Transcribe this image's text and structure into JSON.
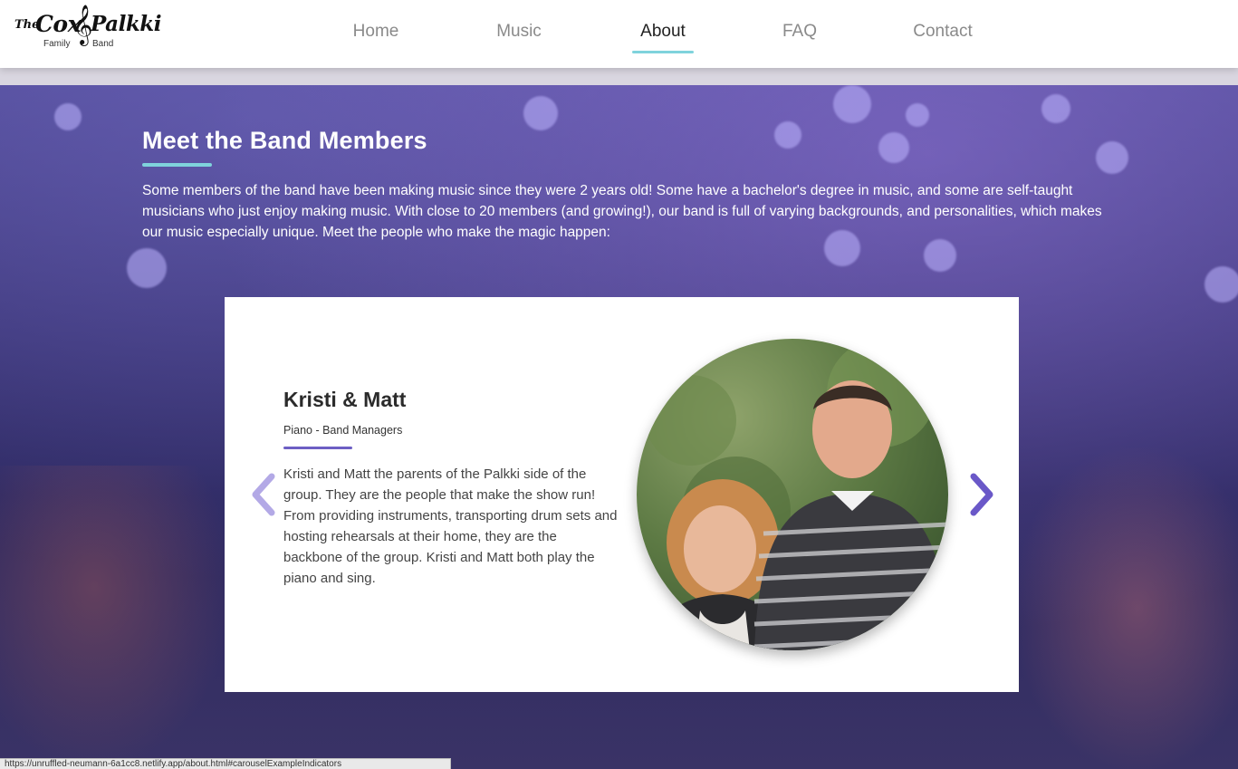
{
  "logo": {
    "the": "The",
    "cox": "Cox",
    "palkki": "Palkki",
    "family": "Family",
    "band": "Band",
    "clef_glyph": "𝄞"
  },
  "nav": {
    "items": [
      {
        "label": "Home"
      },
      {
        "label": "Music"
      },
      {
        "label": "About"
      },
      {
        "label": "FAQ"
      },
      {
        "label": "Contact"
      }
    ],
    "active": "About",
    "accent_color": "#7fd3dc"
  },
  "section": {
    "title": "Meet the Band Members",
    "intro": "Some members of the band have been making music since they were 2 years old! Some have a bachelor's degree in music, and some are self-taught musicians who just enjoy making music. With close to 20 members (and growing!), our band is full of varying backgrounds, and personalities, which makes our music especially unique. Meet the people who make the magic happen:"
  },
  "carousel": {
    "member": {
      "name": "Kristi & Matt",
      "role": "Piano - Band Managers",
      "bio": "Kristi and Matt the parents of the Palkki side of the group. They are the people that make the show run! From providing instruments, transporting drum sets and hosting rehearsals at their home, they are the backbone of the group. Kristi and Matt both play the piano and sing."
    },
    "prev_icon": "chevron-left-icon",
    "next_icon": "chevron-right-icon",
    "arrow_color_prev": "#b3a9e6",
    "arrow_color_next": "#6a58c8"
  },
  "status_bar": {
    "url": "https://unruffled-neumann-6a1cc8.netlify.app/about.html#carouselExampleIndicators"
  }
}
